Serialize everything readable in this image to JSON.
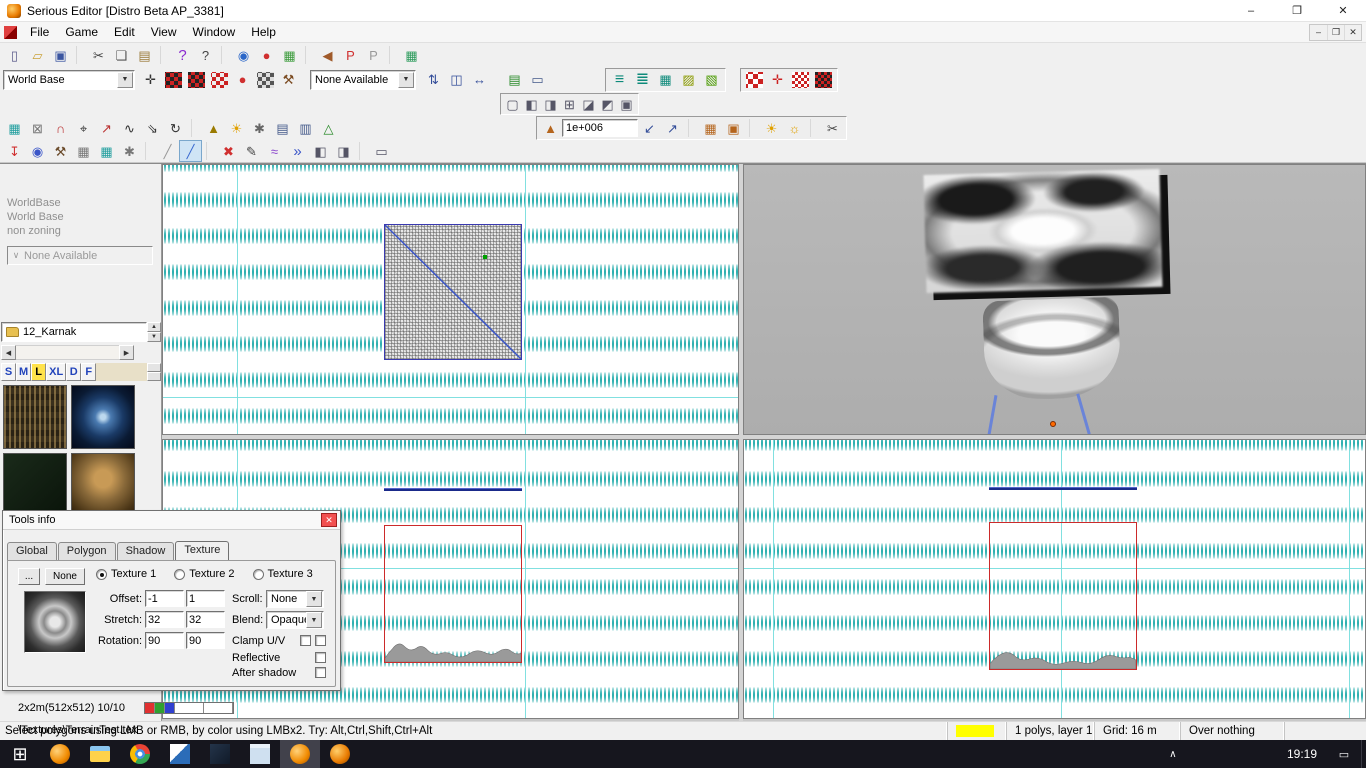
{
  "window": {
    "title": "Serious Editor [Distro Beta AP_3381]",
    "controls": {
      "minimize": "–",
      "maximize": "❐",
      "close": "✕"
    }
  },
  "menu": {
    "items": [
      "File",
      "Game",
      "Edit",
      "View",
      "Window",
      "Help"
    ],
    "mdi_controls": {
      "minimize": "–",
      "restore": "❐",
      "close": "✕"
    }
  },
  "icons": {
    "dropdown_arrow": "▼",
    "combo_check": "∨",
    "spin_up": "▲",
    "spin_down": "▼",
    "scroll_left": "◀",
    "scroll_right": "▶",
    "tray_chevron": "∧",
    "action_center": "▭",
    "dialog_close": "✕"
  },
  "colors": {
    "grid_minor": "#009e9e",
    "grid_major": "#7adede",
    "selection_red": "#cc2a2a",
    "wire_blue": "#1a2a8a",
    "status_highlight": "#ffff00"
  },
  "toolbars": {
    "world_base_combo": "World Base",
    "none_available_combo": "None Available",
    "mip_value": "1e+006",
    "row1": [
      {
        "n": "new-document-icon",
        "g": "▯",
        "c": "#5a5a8a"
      },
      {
        "n": "open-folder-icon",
        "g": "▱",
        "c": "#caa23a"
      },
      {
        "n": "save-icon",
        "g": "▣",
        "c": "#3a55a0"
      },
      {
        "sep": true
      },
      {
        "n": "cut-icon",
        "g": "✂",
        "c": "#444444"
      },
      {
        "n": "copy-icon",
        "g": "❏",
        "c": "#555555"
      },
      {
        "n": "paste-icon",
        "g": "▤",
        "c": "#9a7a3a"
      },
      {
        "sep": true
      },
      {
        "n": "help-icon",
        "g": "?",
        "c": "#8a2ad0",
        "fs": 15
      },
      {
        "n": "context-help-icon",
        "g": "?",
        "c": "#444444"
      },
      {
        "sep": true
      },
      {
        "n": "world-globe-icon",
        "g": "◉",
        "c": "#2a66c8"
      },
      {
        "n": "test-game-icon",
        "g": "●",
        "c": "#d03030"
      },
      {
        "n": "render-preview-icon",
        "g": "▦",
        "c": "#3a9a3a"
      },
      {
        "sep": true
      },
      {
        "n": "navigate-back-icon",
        "g": "◀",
        "c": "#a05a2a"
      },
      {
        "n": "primitive-p-icon",
        "g": "P",
        "c": "#d03030"
      },
      {
        "n": "primitive-p-ghost-icon",
        "g": "P",
        "c": "#9a9a9a"
      },
      {
        "sep": true
      },
      {
        "n": "csg-grid-icon",
        "g": "▦",
        "c": "#2a9a5a"
      }
    ],
    "row2_left": [
      {
        "n": "entity-select-icon",
        "g": "✛",
        "c": "#333333"
      },
      {
        "n": "csg-add-icon",
        "b": "repeating-conic-gradient(#cc2222 0% 25%, #222222 0% 50%) 0 0/8px 8px",
        "cls": "chk"
      },
      {
        "n": "csg-subtract-icon",
        "b": "repeating-conic-gradient(#cc2222 0% 25%, #222222 0% 50%) 2px 2px/8px 8px",
        "cls": "chk"
      },
      {
        "n": "csg-split-icon",
        "b": "repeating-conic-gradient(#cc2222 0% 25%, #eeeeee 0% 50%) 0 0/8px 8px",
        "cls": "chk"
      },
      {
        "n": "csg-join-icon",
        "g": "●",
        "c": "#d03030"
      },
      {
        "n": "csg-deport-icon",
        "b": "repeating-conic-gradient(#555555 0% 25%, #dddddd 0% 50%) 0 0/8px 8px",
        "cls": "chk"
      },
      {
        "n": "split-axe-icon",
        "g": "⚒",
        "c": "#7a4a20"
      }
    ],
    "row2_groupA": [
      {
        "n": "flip-icon",
        "g": "⇅",
        "c": "#334d99"
      },
      {
        "n": "mirror-icon",
        "g": "◫",
        "c": "#334d99"
      },
      {
        "n": "stretch-icon",
        "g": "↔",
        "c": "#334d99"
      }
    ],
    "row2_groupB": [
      {
        "n": "library-icon",
        "g": "▤",
        "c": "#2a8a2a"
      },
      {
        "n": "backdrop-icon",
        "g": "▭",
        "c": "#445a8a"
      }
    ],
    "row2_layers": [
      {
        "n": "layers-list-icon",
        "g": "≡",
        "c": "#0d8a7a",
        "fs": 16
      },
      {
        "n": "layers-add-icon",
        "g": "≣",
        "c": "#0d8a7a",
        "fs": 16
      },
      {
        "n": "layers-grid-icon",
        "g": "▦",
        "c": "#0d8a7a"
      },
      {
        "n": "layers-edit-icon",
        "g": "▨",
        "c": "#8a9a00"
      },
      {
        "n": "layers-fill-icon",
        "g": "▧",
        "c": "#4a9a00"
      }
    ],
    "row2_patterns": [
      {
        "n": "pattern-coarse-icon",
        "b": "repeating-conic-gradient(#cc2222 0% 25%, #ffffff 0% 50%) 0 0/10px 10px",
        "cls": "chk"
      },
      {
        "n": "pattern-add-icon",
        "g": "✛",
        "c": "#cc2222"
      },
      {
        "n": "pattern-fine-icon",
        "b": "repeating-conic-gradient(#cc2222 0% 25%, #ffffff 0% 50%) 0 0/6px 6px",
        "cls": "chk"
      },
      {
        "n": "pattern-mixed-icon",
        "b": "repeating-conic-gradient(#cc2222 0% 25%, #222222 0% 50%) 0 0/6px 6px",
        "cls": "chk"
      }
    ],
    "row3": [
      {
        "n": "window-outline-icon",
        "g": "▢",
        "c": "#555566"
      },
      {
        "n": "window-left-icon",
        "g": "◧",
        "c": "#555566"
      },
      {
        "n": "window-right-icon",
        "g": "◨",
        "c": "#555566"
      },
      {
        "n": "window-grid-icon",
        "g": "⊞",
        "c": "#555566"
      },
      {
        "n": "window-top-icon",
        "g": "◪",
        "c": "#555566"
      },
      {
        "n": "window-corner-icon",
        "g": "◩",
        "c": "#555566"
      },
      {
        "n": "window-full-icon",
        "g": "▣",
        "c": "#555566"
      }
    ],
    "row4_left": [
      {
        "n": "terrain-grid-icon",
        "g": "▦",
        "c": "#1f9e9e"
      },
      {
        "n": "anchor-lock-icon",
        "g": "⊠",
        "c": "#777777"
      },
      {
        "n": "magnet-icon",
        "g": "∩",
        "c": "#bb3333"
      },
      {
        "n": "crosshair-icon",
        "g": "⌖",
        "c": "#333333"
      },
      {
        "n": "move-arrow-icon",
        "g": "↗",
        "c": "#bb3333"
      },
      {
        "n": "falloff-icon",
        "g": "∿",
        "c": "#333333"
      },
      {
        "n": "resize-icon",
        "g": "⇘",
        "c": "#333333"
      },
      {
        "n": "rotate-icon",
        "g": "↻",
        "c": "#333333"
      },
      {
        "sep": true
      },
      {
        "n": "projector-icon",
        "g": "▲",
        "c": "#9a7a00"
      },
      {
        "n": "sun-icon",
        "g": "☀",
        "c": "#e0a000"
      },
      {
        "n": "gear-icon",
        "g": "✱",
        "c": "#666666"
      },
      {
        "n": "texture-a-icon",
        "g": "▤",
        "c": "#445a8a"
      },
      {
        "n": "texture-b-icon",
        "g": "▥",
        "c": "#445a8a"
      },
      {
        "n": "flask-icon",
        "g": "△",
        "c": "#2a8a2a"
      }
    ],
    "row4_terrain_pre": [
      {
        "n": "terrain-raise-icon",
        "g": "▲",
        "c": "#b5651d"
      }
    ],
    "row4_terrain_post": [
      {
        "n": "mip-shrink-icon",
        "g": "↙",
        "c": "#334d99"
      },
      {
        "n": "mip-expand-icon",
        "g": "↗",
        "c": "#334d99"
      },
      {
        "sep": true
      },
      {
        "n": "terrain-tiles-icon",
        "g": "▦",
        "c": "#b5651d"
      },
      {
        "n": "terrain-cell-icon",
        "g": "▣",
        "c": "#b5651d"
      },
      {
        "sep": true
      },
      {
        "n": "shadow-sun-icon",
        "g": "☀",
        "c": "#e0a000"
      },
      {
        "n": "shadow-calc-icon",
        "g": "☼",
        "c": "#e0a000"
      },
      {
        "sep": true
      },
      {
        "n": "terrain-cut-icon",
        "g": "✂",
        "c": "#444444"
      }
    ],
    "row5": [
      {
        "n": "drop-marker-icon",
        "g": "↧",
        "c": "#d03030"
      },
      {
        "n": "world-sphere-icon",
        "g": "◉",
        "c": "#3a55c8"
      },
      {
        "n": "carve-axe-icon",
        "g": "⚒",
        "c": "#6a4a2a"
      },
      {
        "n": "gear-grid-icon",
        "g": "▦",
        "c": "#777777"
      },
      {
        "n": "measure-grid-icon",
        "g": "▦",
        "c": "#1f9e9e"
      },
      {
        "n": "machine-icon",
        "g": "✱",
        "c": "#777777"
      },
      {
        "sep": true
      },
      {
        "n": "pencil-inactive-icon",
        "g": "╱",
        "c": "#999999"
      },
      {
        "n": "pencil-active-icon",
        "g": "╱",
        "c": "#3a6ad0",
        "cls": "active"
      },
      {
        "sep": true
      },
      {
        "n": "delete-poly-icon",
        "g": "✖",
        "c": "#d03030"
      },
      {
        "n": "pencil-icon",
        "g": "✎",
        "c": "#444444"
      },
      {
        "n": "spray-icon",
        "g": "≈",
        "c": "#8a44cc"
      },
      {
        "n": "fast-forward-icon",
        "g": "»",
        "c": "#3a55c8",
        "fs": 15
      },
      {
        "n": "frame-left-icon",
        "g": "◧",
        "c": "#555566"
      },
      {
        "n": "frame-right-icon",
        "g": "◨",
        "c": "#555566"
      },
      {
        "sep": true
      },
      {
        "n": "frame-standalone-icon",
        "g": "▭",
        "c": "#555566"
      }
    ]
  },
  "left_panel": {
    "info_lines": [
      "WorldBase",
      "World Base",
      "non zoning"
    ],
    "disabled_combo": "None Available",
    "texture_group": "12_Karnak",
    "size_tabs": [
      {
        "label": "S"
      },
      {
        "label": "M"
      },
      {
        "label": "L",
        "cls": "sel"
      },
      {
        "label": "XL"
      },
      {
        "label": "D"
      },
      {
        "label": "F"
      }
    ],
    "thumbnails": [
      {
        "n": "texture-thumb-hieroglyphs",
        "b": "repeating-linear-gradient(90deg, rgba(214,178,106,.45) 0 2px, rgba(0,0,0,0) 2px 5px), repeating-linear-gradient(0deg,#2a2214 0 6px,#3a2f1c 6px 12px)"
      },
      {
        "n": "texture-thumb-portal",
        "b": "radial-gradient(circle at 50% 50%, #bcd8ee 0 6%, #4a7ab0 18%, #1a3a66 45%, #0a1a33 70%, #040a1a 100%)"
      },
      {
        "n": "texture-thumb-dark",
        "b": "linear-gradient(135deg,#1a2a1a,#0a140a)"
      },
      {
        "n": "texture-thumb-face",
        "b": "radial-gradient(circle at 50% 40%, #c89a56 0 18%, #8a6a3a 45%, #4a3516 80%, #2a1c0a 100%)"
      },
      {
        "n": "texture-thumb-mask",
        "b": "radial-gradient(circle at 50% 42%, #e0c070 0 20%, #a8824a 50%, #5a4220 85%, #32220e 100%)"
      },
      {
        "n": "texture-thumb-clip",
        "b": "linear-gradient(135deg,#3a2a14,#1a1208)"
      }
    ]
  },
  "tools_info": {
    "title": "Tools info",
    "tabs": [
      {
        "label": "Global"
      },
      {
        "label": "Polygon"
      },
      {
        "label": "Shadow"
      },
      {
        "label": "Texture",
        "cls": "active"
      }
    ],
    "browse_label": "...",
    "none_label": "None",
    "radios": [
      {
        "label": "Texture 1",
        "cls": "checked"
      },
      {
        "label": "Texture 2"
      },
      {
        "label": "Texture 3"
      }
    ],
    "offset_label": "Offset:",
    "stretch_label": "Stretch:",
    "rotation_label": "Rotation:",
    "offset_values": [
      "-1",
      "1"
    ],
    "stretch_values": [
      "32",
      "32"
    ],
    "rotation_values": [
      "90",
      "90"
    ],
    "scroll_label": "Scroll:",
    "scroll_value": "None",
    "blend_label": "Blend:",
    "blend_value": "Opaque",
    "clamp_label": "Clamp U/V",
    "reflective_label": "Reflective",
    "after_shadow_label": "After shadow",
    "size_info": "2x2m(512x512) 10/10",
    "texture_path": "\\Textures\\TerrainTest.tex",
    "swatches": [
      {
        "n": "swatch-red",
        "b": "#e03030"
      },
      {
        "n": "swatch-green",
        "b": "#30a030"
      },
      {
        "n": "swatch-blue",
        "b": "#3040d0"
      },
      {
        "n": "swatch-white-1",
        "b": "#ffffff",
        "cls": "wide"
      },
      {
        "n": "swatch-white-2",
        "b": "#ffffff",
        "cls": "wide"
      }
    ]
  },
  "status_bar": {
    "message": "Select polygons using LMB or RMB, by color using LMBx2. Try: Alt,Ctrl,Shift,Ctrl+Alt",
    "polys": "1 polys, layer 1",
    "grid": "Grid: 16 m",
    "over": "Over nothing"
  },
  "taskbar": {
    "time": "19:19",
    "apps": [
      {
        "n": "start-button",
        "g": "⊞",
        "c": "#ffffff",
        "fs": 18
      },
      {
        "n": "taskbar-game-icon",
        "b": "radial-gradient(circle at 35% 35%, #ffd27a, #f08a00 60%, #a85400 95%)",
        "cls": "round"
      },
      {
        "n": "taskbar-explorer-icon",
        "b": "linear-gradient(180deg,#8ac6f0 0 30%,#ffd24a 30%)",
        "cls": "folder"
      },
      {
        "n": "taskbar-chrome-icon",
        "b": "radial-gradient(circle at 50% 50%, #ffffff 0 16%, #4a90e2 17% 34%, rgba(0,0,0,0) 35%), conic-gradient(from -30deg, #ea4335 0 33%, #34a853 0 66%, #fbbc05 0 100%)",
        "cls": "round"
      },
      {
        "n": "taskbar-document-app-icon",
        "b": "linear-gradient(135deg,#ffffff 0 45%,#2b6cb8 45%)"
      },
      {
        "n": "taskbar-dark-app-icon",
        "b": "linear-gradient(135deg,#24344a,#101a28)"
      },
      {
        "n": "taskbar-notes-app-icon",
        "b": "linear-gradient(180deg,#eaf2fa 0 20%,#cfe0f0 20%)"
      },
      {
        "n": "taskbar-serious-editor-icon",
        "b": "radial-gradient(circle at 35% 35%, #ffd27a, #f08a00 60%, #a85400 95%)",
        "cls": "round active"
      },
      {
        "n": "taskbar-serious-game-icon",
        "b": "radial-gradient(circle at 35% 35%, #ffcf6a, #e87a00 60%, #904800 95%)",
        "cls": "round"
      }
    ]
  }
}
